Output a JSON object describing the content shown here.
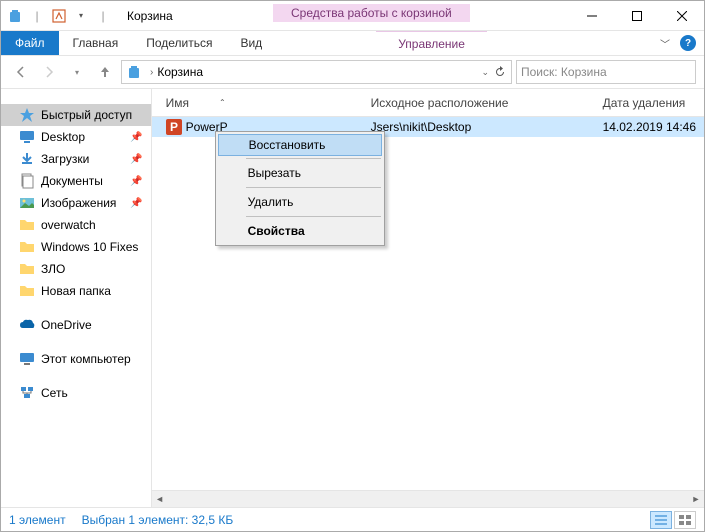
{
  "window": {
    "title": "Корзина",
    "context_tab_upper": "Средства работы с корзиной",
    "context_tab_lower": "Управление"
  },
  "ribbon": {
    "file": "Файл",
    "tabs": [
      "Главная",
      "Поделиться",
      "Вид"
    ]
  },
  "addressbar": {
    "location": "Корзина",
    "search_placeholder": "Поиск: Корзина"
  },
  "sidebar": {
    "quick_access": "Быстрый доступ",
    "pinned": [
      {
        "label": "Desktop",
        "icon": "desktop"
      },
      {
        "label": "Загрузки",
        "icon": "downloads"
      },
      {
        "label": "Документы",
        "icon": "documents"
      },
      {
        "label": "Изображения",
        "icon": "pictures"
      }
    ],
    "recent": [
      {
        "label": "overwatch"
      },
      {
        "label": "Windows 10 Fixes"
      },
      {
        "label": "ЗЛО"
      },
      {
        "label": "Новая папка"
      }
    ],
    "onedrive": "OneDrive",
    "this_pc": "Этот компьютер",
    "network": "Сеть"
  },
  "columns": {
    "name": "Имя",
    "location": "Исходное расположение",
    "date": "Дата удаления"
  },
  "items": [
    {
      "name": "PowerP",
      "location": "Jsers\\nikit\\Desktop",
      "date": "14.02.2019 14:46",
      "icon": "powerpoint"
    }
  ],
  "context_menu": {
    "restore": "Восстановить",
    "cut": "Вырезать",
    "delete": "Удалить",
    "properties": "Свойства"
  },
  "status": {
    "count": "1 элемент",
    "selection": "Выбран 1 элемент: 32,5 КБ"
  }
}
